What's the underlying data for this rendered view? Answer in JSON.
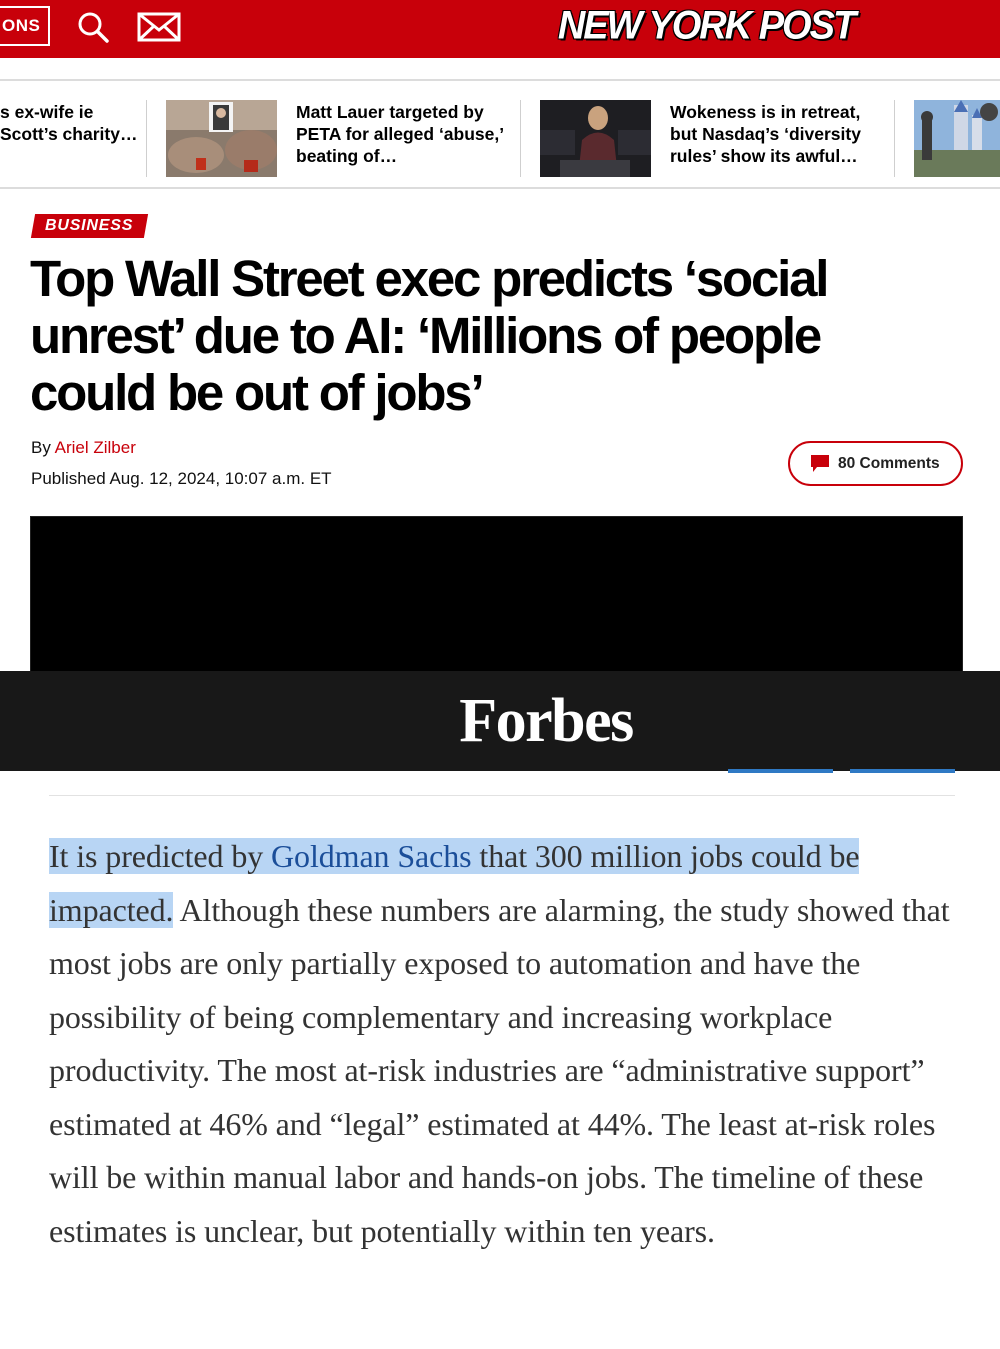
{
  "header": {
    "sections_label": "ONS",
    "logo_text": "NEW YORK POST",
    "brand_color": "#c8000a"
  },
  "story_strip": [
    {
      "text": "s ex-wife ie Scott’s charity…"
    },
    {
      "text": "Matt Lauer targeted by PETA for alleged ‘abuse,’ beating of…"
    },
    {
      "text": "Wokeness is in retreat, but Nasdaq’s ‘diversity rules’ show its awful…"
    }
  ],
  "article": {
    "category": "BUSINESS",
    "headline": "Top Wall Street exec predicts ‘social unrest’ due to AI: ‘Millions of people could be out of jobs’",
    "byline_prefix": "By",
    "author": "Ariel Zilber",
    "published": "Published Aug. 12, 2024, 10:07 a.m. ET",
    "comments_label": "80 Comments"
  },
  "forbes": {
    "logo": "Forbes",
    "para_highlight_1": "It is predicted by ",
    "para_link": "Goldman Sachs",
    "para_highlight_2": " that 300 million jobs could be impacted.",
    "para_rest": " Although these numbers are alarming, the study showed that most jobs are only partially exposed to automation and have the possibility of being complementary and increasing workplace productivity. The most at-risk industries are “administrative support” estimated at 46% and “legal” estimated at 44%. The least at-risk roles will be within manual labor and hands-on jobs. The timeline of these estimates is unclear, but potentially within ten years."
  }
}
